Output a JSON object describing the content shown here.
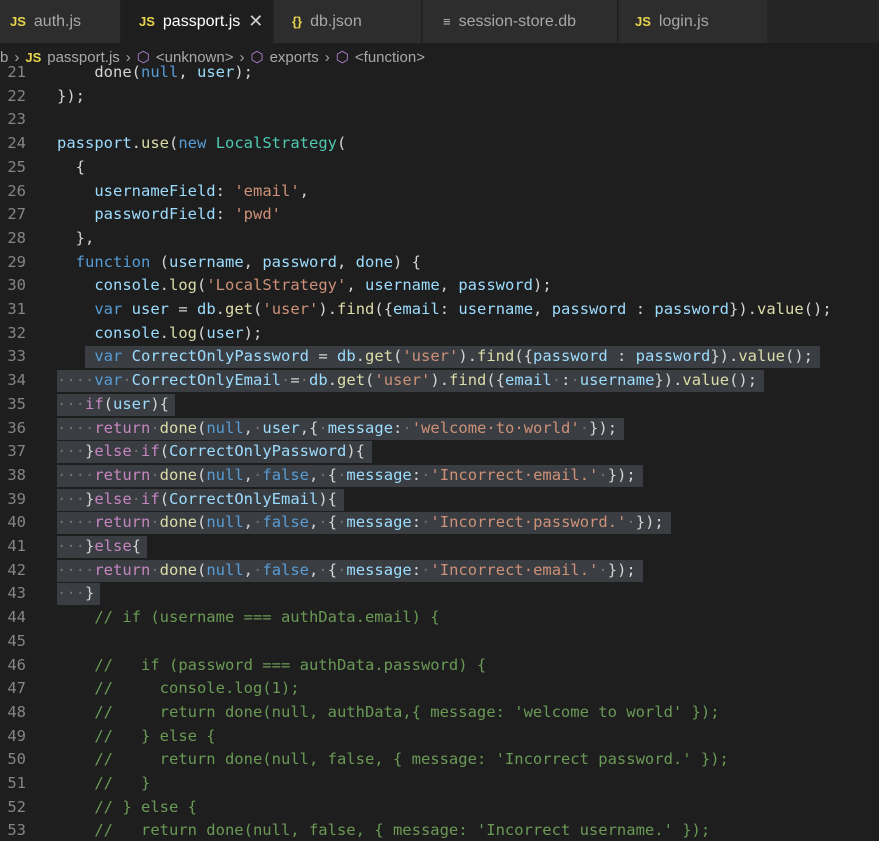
{
  "tabs": [
    {
      "label": "auth.js",
      "icon": "js-file-icon",
      "badge": "JS"
    },
    {
      "label": "passport.js",
      "icon": "js-file-icon",
      "badge": "JS",
      "active": true
    },
    {
      "label": "db.json",
      "icon": "json-file-icon",
      "badge": "{}"
    },
    {
      "label": "session-store.db",
      "icon": "db-file-icon",
      "badge": "≡"
    },
    {
      "label": "login.js",
      "icon": "js-file-icon",
      "badge": "JS"
    }
  ],
  "breadcrumb": [
    "b",
    "passport.js",
    "<unknown>",
    "exports",
    "<function>"
  ],
  "editor": {
    "lines": [
      {
        "n": "21",
        "tokens": [
          [
            "pl",
            "    done("
          ],
          [
            "kw",
            "null"
          ],
          [
            "pl",
            ", "
          ],
          [
            "var",
            "user"
          ],
          [
            "pl",
            ");"
          ]
        ]
      },
      {
        "n": "22",
        "tokens": [
          [
            "pl",
            "});"
          ]
        ]
      },
      {
        "n": "23",
        "tokens": []
      },
      {
        "n": "24",
        "tokens": [
          [
            "var",
            "passport"
          ],
          [
            "pl",
            "."
          ],
          [
            "fn",
            "use"
          ],
          [
            "pl",
            "("
          ],
          [
            "kw",
            "new"
          ],
          [
            "pl",
            " "
          ],
          [
            "cls",
            "LocalStrategy"
          ],
          [
            "pl",
            "("
          ]
        ]
      },
      {
        "n": "25",
        "tokens": [
          [
            "pl",
            "  {"
          ]
        ]
      },
      {
        "n": "26",
        "tokens": [
          [
            "pl",
            "    "
          ],
          [
            "var",
            "usernameField"
          ],
          [
            "pl",
            ": "
          ],
          [
            "str",
            "'email'"
          ],
          [
            "pl",
            ","
          ]
        ]
      },
      {
        "n": "27",
        "tokens": [
          [
            "pl",
            "    "
          ],
          [
            "var",
            "passwordField"
          ],
          [
            "pl",
            ": "
          ],
          [
            "str",
            "'pwd'"
          ]
        ]
      },
      {
        "n": "28",
        "tokens": [
          [
            "pl",
            "  },"
          ]
        ]
      },
      {
        "n": "29",
        "tokens": [
          [
            "pl",
            "  "
          ],
          [
            "kw",
            "function"
          ],
          [
            "pl",
            " ("
          ],
          [
            "var",
            "username"
          ],
          [
            "pl",
            ", "
          ],
          [
            "var",
            "password"
          ],
          [
            "pl",
            ", "
          ],
          [
            "var",
            "done"
          ],
          [
            "pl",
            ") {"
          ]
        ]
      },
      {
        "n": "30",
        "tokens": [
          [
            "pl",
            "    "
          ],
          [
            "var",
            "console"
          ],
          [
            "pl",
            "."
          ],
          [
            "fn",
            "log"
          ],
          [
            "pl",
            "("
          ],
          [
            "str",
            "'LocalStrategy'"
          ],
          [
            "pl",
            ", "
          ],
          [
            "var",
            "username"
          ],
          [
            "pl",
            ", "
          ],
          [
            "var",
            "password"
          ],
          [
            "pl",
            ");"
          ]
        ]
      },
      {
        "n": "31",
        "tokens": [
          [
            "pl",
            "    "
          ],
          [
            "kw",
            "var"
          ],
          [
            "pl",
            " "
          ],
          [
            "var",
            "user"
          ],
          [
            "pl",
            " = "
          ],
          [
            "var",
            "db"
          ],
          [
            "pl",
            "."
          ],
          [
            "fn",
            "get"
          ],
          [
            "pl",
            "("
          ],
          [
            "str",
            "'user'"
          ],
          [
            "pl",
            ")."
          ],
          [
            "fn",
            "find"
          ],
          [
            "pl",
            "({"
          ],
          [
            "var",
            "email"
          ],
          [
            "pl",
            ": "
          ],
          [
            "var",
            "username"
          ],
          [
            "pl",
            ", "
          ],
          [
            "var",
            "password"
          ],
          [
            "pl",
            " : "
          ],
          [
            "var",
            "password"
          ],
          [
            "pl",
            "})."
          ],
          [
            "fn",
            "value"
          ],
          [
            "pl",
            "();"
          ]
        ]
      },
      {
        "n": "32",
        "tokens": [
          [
            "pl",
            "    "
          ],
          [
            "var",
            "console"
          ],
          [
            "pl",
            "."
          ],
          [
            "fn",
            "log"
          ],
          [
            "pl",
            "("
          ],
          [
            "var",
            "user"
          ],
          [
            "pl",
            ");"
          ]
        ]
      },
      {
        "n": "33",
        "sel": true,
        "tokens": [
          [
            "pl",
            "    "
          ],
          [
            "kw",
            "var"
          ],
          [
            "pl",
            " "
          ],
          [
            "var",
            "CorrectOnlyPassword"
          ],
          [
            "pl",
            " = "
          ],
          [
            "var",
            "db"
          ],
          [
            "pl",
            "."
          ],
          [
            "fn",
            "get"
          ],
          [
            "pl",
            "("
          ],
          [
            "str",
            "'user'"
          ],
          [
            "pl",
            ")."
          ],
          [
            "fn",
            "find"
          ],
          [
            "pl",
            "({"
          ],
          [
            "var",
            "password"
          ],
          [
            "pl",
            " : "
          ],
          [
            "var",
            "password"
          ],
          [
            "pl",
            "})."
          ],
          [
            "fn",
            "value"
          ],
          [
            "pl",
            "();"
          ]
        ]
      },
      {
        "n": "34",
        "sel": true,
        "tokens": [
          [
            "dot",
            "····"
          ],
          [
            "kw",
            "var"
          ],
          [
            "dot",
            "·"
          ],
          [
            "var",
            "CorrectOnlyEmail"
          ],
          [
            "dot",
            "·"
          ],
          [
            "pl",
            "="
          ],
          [
            "dot",
            "·"
          ],
          [
            "var",
            "db"
          ],
          [
            "pl",
            "."
          ],
          [
            "fn",
            "get"
          ],
          [
            "pl",
            "("
          ],
          [
            "str",
            "'user'"
          ],
          [
            "pl",
            ")."
          ],
          [
            "fn",
            "find"
          ],
          [
            "pl",
            "({"
          ],
          [
            "var",
            "email"
          ],
          [
            "dot",
            "·"
          ],
          [
            "pl",
            ":"
          ],
          [
            "dot",
            "·"
          ],
          [
            "var",
            "username"
          ],
          [
            "pl",
            "})."
          ],
          [
            "fn",
            "value"
          ],
          [
            "pl",
            "();"
          ]
        ]
      },
      {
        "n": "35",
        "sel": true,
        "tokens": [
          [
            "dot",
            "···"
          ],
          [
            "kw2",
            "if"
          ],
          [
            "pl",
            "("
          ],
          [
            "var",
            "user"
          ],
          [
            "pl",
            "){"
          ]
        ]
      },
      {
        "n": "36",
        "sel": true,
        "tokens": [
          [
            "dot",
            "····"
          ],
          [
            "kw2",
            "return"
          ],
          [
            "dot",
            "·"
          ],
          [
            "fn",
            "done"
          ],
          [
            "pl",
            "("
          ],
          [
            "kw",
            "null"
          ],
          [
            "pl",
            ","
          ],
          [
            "dot",
            "·"
          ],
          [
            "var",
            "user"
          ],
          [
            "pl",
            ",{"
          ],
          [
            "dot",
            "·"
          ],
          [
            "var",
            "message"
          ],
          [
            "pl",
            ":"
          ],
          [
            "dot",
            "·"
          ],
          [
            "str",
            "'welcome·to·world'"
          ],
          [
            "dot",
            "·"
          ],
          [
            "pl",
            "});"
          ]
        ]
      },
      {
        "n": "37",
        "sel": true,
        "tokens": [
          [
            "dot",
            "···"
          ],
          [
            "pl",
            "}"
          ],
          [
            "kw2",
            "else"
          ],
          [
            "dot",
            "·"
          ],
          [
            "kw2",
            "if"
          ],
          [
            "pl",
            "("
          ],
          [
            "var",
            "CorrectOnlyPassword"
          ],
          [
            "pl",
            "){"
          ]
        ]
      },
      {
        "n": "38",
        "sel": true,
        "tokens": [
          [
            "dot",
            "····"
          ],
          [
            "kw2",
            "return"
          ],
          [
            "dot",
            "·"
          ],
          [
            "fn",
            "done"
          ],
          [
            "pl",
            "("
          ],
          [
            "kw",
            "null"
          ],
          [
            "pl",
            ","
          ],
          [
            "dot",
            "·"
          ],
          [
            "kw",
            "false"
          ],
          [
            "pl",
            ","
          ],
          [
            "dot",
            "·"
          ],
          [
            "pl",
            "{"
          ],
          [
            "dot",
            "·"
          ],
          [
            "var",
            "message"
          ],
          [
            "pl",
            ":"
          ],
          [
            "dot",
            "·"
          ],
          [
            "str",
            "'Incorrect·email.'"
          ],
          [
            "dot",
            "·"
          ],
          [
            "pl",
            "});"
          ]
        ]
      },
      {
        "n": "39",
        "sel": true,
        "tokens": [
          [
            "dot",
            "···"
          ],
          [
            "pl",
            "}"
          ],
          [
            "kw2",
            "else"
          ],
          [
            "dot",
            "·"
          ],
          [
            "kw2",
            "if"
          ],
          [
            "pl",
            "("
          ],
          [
            "var",
            "CorrectOnlyEmail"
          ],
          [
            "pl",
            "){"
          ]
        ]
      },
      {
        "n": "40",
        "sel": true,
        "tokens": [
          [
            "dot",
            "····"
          ],
          [
            "kw2",
            "return"
          ],
          [
            "dot",
            "·"
          ],
          [
            "fn",
            "done"
          ],
          [
            "pl",
            "("
          ],
          [
            "kw",
            "null"
          ],
          [
            "pl",
            ","
          ],
          [
            "dot",
            "·"
          ],
          [
            "kw",
            "false"
          ],
          [
            "pl",
            ","
          ],
          [
            "dot",
            "·"
          ],
          [
            "pl",
            "{"
          ],
          [
            "dot",
            "·"
          ],
          [
            "var",
            "message"
          ],
          [
            "pl",
            ":"
          ],
          [
            "dot",
            "·"
          ],
          [
            "str",
            "'Incorrect·password.'"
          ],
          [
            "dot",
            "·"
          ],
          [
            "pl",
            "});"
          ]
        ]
      },
      {
        "n": "41",
        "sel": true,
        "tokens": [
          [
            "dot",
            "···"
          ],
          [
            "pl",
            "}"
          ],
          [
            "kw2",
            "else"
          ],
          [
            "pl",
            "{"
          ]
        ]
      },
      {
        "n": "42",
        "sel": true,
        "tokens": [
          [
            "dot",
            "····"
          ],
          [
            "kw2",
            "return"
          ],
          [
            "dot",
            "·"
          ],
          [
            "fn",
            "done"
          ],
          [
            "pl",
            "("
          ],
          [
            "kw",
            "null"
          ],
          [
            "pl",
            ","
          ],
          [
            "dot",
            "·"
          ],
          [
            "kw",
            "false"
          ],
          [
            "pl",
            ","
          ],
          [
            "dot",
            "·"
          ],
          [
            "pl",
            "{"
          ],
          [
            "dot",
            "·"
          ],
          [
            "var",
            "message"
          ],
          [
            "pl",
            ":"
          ],
          [
            "dot",
            "·"
          ],
          [
            "str",
            "'Incorrect·email.'"
          ],
          [
            "dot",
            "·"
          ],
          [
            "pl",
            "});"
          ]
        ]
      },
      {
        "n": "43",
        "sel": true,
        "tokens": [
          [
            "dot",
            "···"
          ],
          [
            "pl",
            "}"
          ]
        ]
      },
      {
        "n": "44",
        "tokens": [
          [
            "com",
            "    // if (username === authData.email) {"
          ]
        ]
      },
      {
        "n": "45",
        "tokens": []
      },
      {
        "n": "46",
        "tokens": [
          [
            "com",
            "    //   if (password === authData.password) {"
          ]
        ]
      },
      {
        "n": "47",
        "tokens": [
          [
            "com",
            "    //     console.log(1);"
          ]
        ]
      },
      {
        "n": "48",
        "tokens": [
          [
            "com",
            "    //     return done(null, authData,{ message: 'welcome to world' });"
          ]
        ]
      },
      {
        "n": "49",
        "tokens": [
          [
            "com",
            "    //   } else {"
          ]
        ]
      },
      {
        "n": "50",
        "tokens": [
          [
            "com",
            "    //     return done(null, false, { message: 'Incorrect password.' });"
          ]
        ]
      },
      {
        "n": "51",
        "tokens": [
          [
            "com",
            "    //   }"
          ]
        ]
      },
      {
        "n": "52",
        "tokens": [
          [
            "com",
            "    // } else {"
          ]
        ]
      },
      {
        "n": "53",
        "tokens": [
          [
            "com",
            "    //   return done(null, false, { message: 'Incorrect username.' });"
          ]
        ]
      }
    ]
  }
}
